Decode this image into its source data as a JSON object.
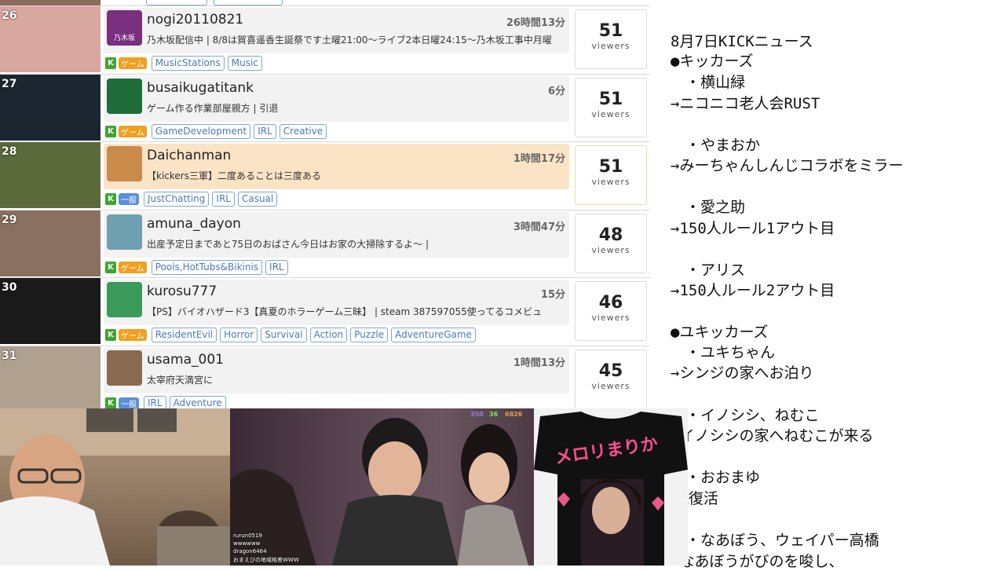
{
  "streams": [
    {
      "rank": "26",
      "name": "nogi20110821",
      "duration": "26時間13分",
      "title": "乃木坂配信中 | 8/8は賀喜遥香生誕祭です土曜21:00〜ライブ2本日曜24:15〜乃木坂工事中月曜",
      "category": "ゲーム",
      "category_type": "game",
      "tags": [
        "MusicStations",
        "Music"
      ],
      "viewers": "51",
      "viewers_label": "viewers",
      "highlight": false,
      "thumb_color": "#d8a7a0",
      "avatar_color": "#7a2f7f",
      "avatar_text": "乃木坂"
    },
    {
      "rank": "27",
      "name": "busaikugatitank",
      "duration": "6分",
      "title": "ゲーム作る作業部屋親方 | 引退",
      "category": "ゲーム",
      "category_type": "game",
      "tags": [
        "GameDevelopment",
        "IRL",
        "Creative"
      ],
      "viewers": "51",
      "viewers_label": "viewers",
      "highlight": false,
      "thumb_color": "#1b2630",
      "avatar_color": "#1f6e3a",
      "avatar_text": ""
    },
    {
      "rank": "28",
      "name": "Daichanman",
      "duration": "1時間17分",
      "title": "【kickers三軍】二度あることは三度ある",
      "category": "一般",
      "category_type": "general",
      "tags": [
        "JustChatting",
        "IRL",
        "Casual"
      ],
      "viewers": "51",
      "viewers_label": "viewers",
      "highlight": true,
      "thumb_color": "#5a6a3a",
      "avatar_color": "#c98a4a",
      "avatar_text": ""
    },
    {
      "rank": "29",
      "name": "amuna_dayon",
      "duration": "3時間47分",
      "title": "出産予定日まであと75日のおばさん今日はお家の大掃除するよ〜 |",
      "category": "ゲーム",
      "category_type": "game",
      "tags": [
        "Pools,HotTubs&Bikinis",
        "IRL"
      ],
      "viewers": "48",
      "viewers_label": "viewers",
      "highlight": false,
      "thumb_color": "#8a7060",
      "avatar_color": "#6fa0b0",
      "avatar_text": ""
    },
    {
      "rank": "30",
      "name": "kurosu777",
      "duration": "15分",
      "title": "【PS】バイオハザード3【真夏のホラーゲーム三昧】 | steam 387597055使ってるコメビュ",
      "category": "ゲーム",
      "category_type": "game",
      "tags": [
        "ResidentEvil",
        "Horror",
        "Survival",
        "Action",
        "Puzzle",
        "AdventureGame"
      ],
      "viewers": "46",
      "viewers_label": "viewers",
      "highlight": false,
      "thumb_color": "#1a1a1a",
      "avatar_color": "#3a9a5a",
      "avatar_text": ""
    },
    {
      "rank": "31",
      "name": "usama_001",
      "duration": "1時間13分",
      "title": "太宰府天満宮に",
      "category": "一般",
      "category_type": "general",
      "tags": [
        "IRL",
        "Adventure"
      ],
      "viewers": "45",
      "viewers_label": "viewers",
      "highlight": false,
      "thumb_color": "#b0a090",
      "avatar_color": "#8a6a50",
      "avatar_text": ""
    }
  ],
  "notes": [
    "8月7日KICKニュース",
    "●キッカーズ",
    "　・横山緑",
    "→ニコニコ老人会RUST",
    "",
    "　・やまおか",
    "→みーちゃんしんじコラボをミラー",
    "",
    "　・愛之助",
    "→150人ルール1アウト目",
    "",
    "　・アリス",
    "→150人ルール2アウト目",
    "",
    "●ユキッカーズ",
    "　・ユキちゃん",
    "→シンジの家へお泊り",
    "",
    "　・イノシシ、ねむこ",
    "→イノシシの家へねむこが来る",
    "",
    "　・おおまゆ",
    "→X復活",
    "",
    "　・なあぼう、ウェイパー高橋",
    "→なあぼうがびのを唆し、"
  ],
  "camera2": {
    "stats": [
      "350",
      "36",
      "6826"
    ],
    "stat_colors": [
      "#9a7ae0",
      "#8ae04a",
      "#e0a04a"
    ],
    "chat": [
      "rurun0519",
      "wwwwww",
      "dragon6464",
      "おまえびの地域格差WWW"
    ]
  },
  "camera3": {
    "shirt_text": "メロリまりか"
  }
}
